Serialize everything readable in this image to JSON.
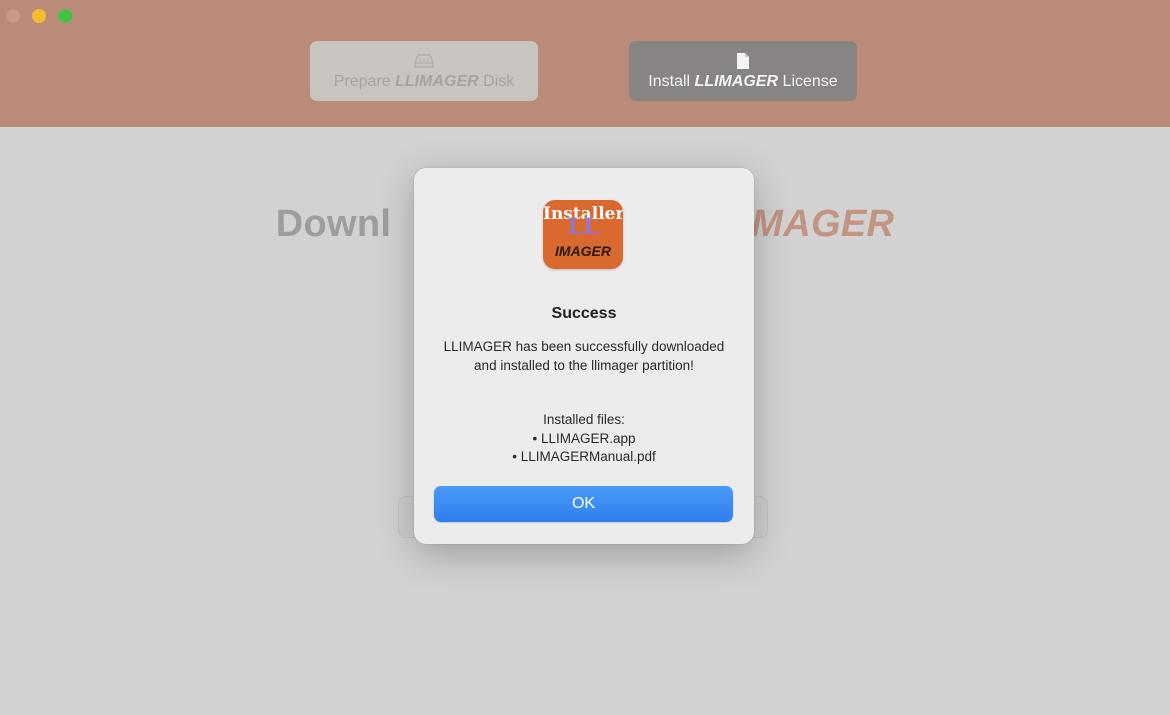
{
  "toolbar": {
    "prepare_prefix": "Prepare ",
    "prepare_brand": "LLIMAGER",
    "prepare_suffix": " Disk",
    "install_prefix": "Install ",
    "install_brand": "LLIMAGER",
    "install_suffix": " License",
    "icons": {
      "prepare": "disk-icon",
      "install": "document-icon"
    }
  },
  "content": {
    "title_visible_left": "Downl",
    "title_visible_right": "MAGER"
  },
  "dialog": {
    "icon_text_top": "Installer",
    "icon_text_mid": "LL",
    "icon_text_bottom": "IMAGER",
    "title": "Success",
    "message": "LLIMAGER has been successfully downloaded and installed to the llimager partition!",
    "files_header": "Installed files:",
    "files": [
      "• LLIMAGER.app",
      "• LLIMAGERManual.pdf"
    ],
    "ok_label": "OK"
  },
  "colors": {
    "toolbar": "#bb8b79",
    "accent": "#2f7ef0",
    "brand": "#c29583",
    "traffic_min": "#f2bd2f",
    "traffic_max": "#45c341"
  }
}
